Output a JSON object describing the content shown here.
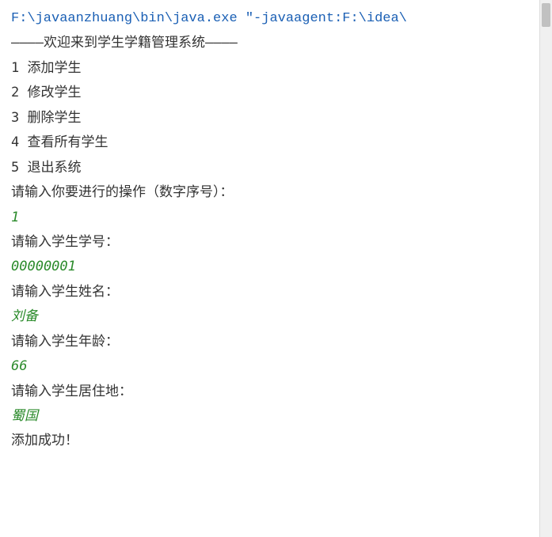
{
  "command": "F:\\javaanzhuang\\bin\\java.exe \"-javaagent:F:\\idea\\",
  "welcome": "————欢迎来到学生学籍管理系统————",
  "menu": {
    "items": [
      "1 添加学生",
      "2 修改学生",
      "3 删除学生",
      "4 查看所有学生",
      "5 退出系统"
    ]
  },
  "prompts": {
    "operation": "请输入你要进行的操作（数字序号）：",
    "student_id": "请输入学生学号：",
    "student_name": "请输入学生姓名：",
    "student_age": "请输入学生年龄：",
    "student_address": "请输入学生居住地："
  },
  "inputs": {
    "operation": "1",
    "student_id": "00000001",
    "student_name": "刘备",
    "student_age": "66",
    "student_address": "蜀国"
  },
  "result": "添加成功！"
}
